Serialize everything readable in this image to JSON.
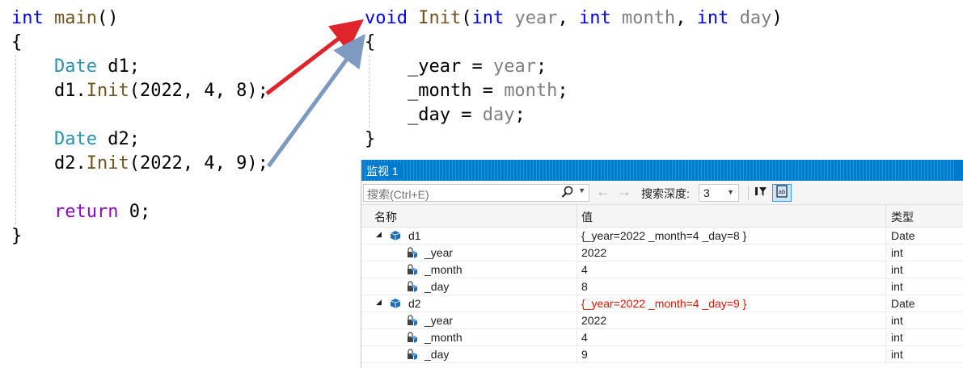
{
  "editor": {
    "left": [
      {
        "parts": [
          {
            "c": "kw",
            "t": "int"
          },
          {
            "c": "txt",
            "t": " "
          },
          {
            "c": "fn",
            "t": "main"
          },
          {
            "c": "txt",
            "t": "()"
          }
        ]
      },
      {
        "parts": [
          {
            "c": "txt",
            "t": "{"
          }
        ]
      },
      {
        "parts": [
          {
            "c": "txt",
            "t": "    "
          },
          {
            "c": "ty",
            "t": "Date"
          },
          {
            "c": "txt",
            "t": " d1;"
          }
        ]
      },
      {
        "parts": [
          {
            "c": "txt",
            "t": "    d1."
          },
          {
            "c": "fn",
            "t": "Init"
          },
          {
            "c": "txt",
            "t": "(2022, 4, 8);"
          }
        ]
      },
      {
        "parts": []
      },
      {
        "parts": [
          {
            "c": "txt",
            "t": "    "
          },
          {
            "c": "ty",
            "t": "Date"
          },
          {
            "c": "txt",
            "t": " d2;"
          }
        ]
      },
      {
        "parts": [
          {
            "c": "txt",
            "t": "    d2."
          },
          {
            "c": "fn",
            "t": "Init"
          },
          {
            "c": "txt",
            "t": "(2022, 4, 9);"
          }
        ]
      },
      {
        "parts": []
      },
      {
        "parts": [
          {
            "c": "txt",
            "t": "    "
          },
          {
            "c": "kw2",
            "t": "return"
          },
          {
            "c": "txt",
            "t": " 0;"
          }
        ]
      },
      {
        "parts": [
          {
            "c": "txt",
            "t": "}"
          }
        ]
      }
    ],
    "right": [
      {
        "parts": [
          {
            "c": "kw",
            "t": "void"
          },
          {
            "c": "txt",
            "t": " "
          },
          {
            "c": "fn",
            "t": "Init"
          },
          {
            "c": "txt",
            "t": "("
          },
          {
            "c": "kw",
            "t": "int"
          },
          {
            "c": "txt",
            "t": " "
          },
          {
            "c": "par",
            "t": "year"
          },
          {
            "c": "txt",
            "t": ", "
          },
          {
            "c": "kw",
            "t": "int"
          },
          {
            "c": "txt",
            "t": " "
          },
          {
            "c": "par",
            "t": "month"
          },
          {
            "c": "txt",
            "t": ", "
          },
          {
            "c": "kw",
            "t": "int"
          },
          {
            "c": "txt",
            "t": " "
          },
          {
            "c": "par",
            "t": "day"
          },
          {
            "c": "txt",
            "t": ")"
          }
        ]
      },
      {
        "parts": [
          {
            "c": "txt",
            "t": "{"
          }
        ]
      },
      {
        "parts": [
          {
            "c": "txt",
            "t": "    _year = "
          },
          {
            "c": "par",
            "t": "year"
          },
          {
            "c": "txt",
            "t": ";"
          }
        ]
      },
      {
        "parts": [
          {
            "c": "txt",
            "t": "    _month = "
          },
          {
            "c": "par",
            "t": "month"
          },
          {
            "c": "txt",
            "t": ";"
          }
        ]
      },
      {
        "parts": [
          {
            "c": "txt",
            "t": "    _day = "
          },
          {
            "c": "par",
            "t": "day"
          },
          {
            "c": "txt",
            "t": ";"
          }
        ]
      },
      {
        "parts": [
          {
            "c": "txt",
            "t": "}"
          }
        ]
      }
    ]
  },
  "colors": {
    "arrow1": "#e0242b",
    "arrow2": "#7d9ac0",
    "titlebar": "#007acc"
  },
  "watch": {
    "title": "监视 1",
    "search_placeholder": "搜索(Ctrl+E)",
    "search_icon": "search-icon",
    "back_icon": "←",
    "forward_icon": "→",
    "depth_label": "搜索深度:",
    "depth_value": "3",
    "headers": {
      "name": "名称",
      "value": "值",
      "type": "类型"
    },
    "rows": [
      {
        "level": 0,
        "expanded": true,
        "name": "d1",
        "value": "{_year=2022 _month=4 _day=8 }",
        "type": "Date",
        "changed": false
      },
      {
        "level": 1,
        "name": "_year",
        "value": "2022",
        "type": "int"
      },
      {
        "level": 1,
        "name": "_month",
        "value": "4",
        "type": "int"
      },
      {
        "level": 1,
        "name": "_day",
        "value": "8",
        "type": "int"
      },
      {
        "level": 0,
        "expanded": true,
        "name": "d2",
        "value": "{_year=2022 _month=4 _day=9 }",
        "type": "Date",
        "changed": true
      },
      {
        "level": 1,
        "name": "_year",
        "value": "2022",
        "type": "int"
      },
      {
        "level": 1,
        "name": "_month",
        "value": "4",
        "type": "int"
      },
      {
        "level": 1,
        "name": "_day",
        "value": "9",
        "type": "int"
      }
    ]
  }
}
